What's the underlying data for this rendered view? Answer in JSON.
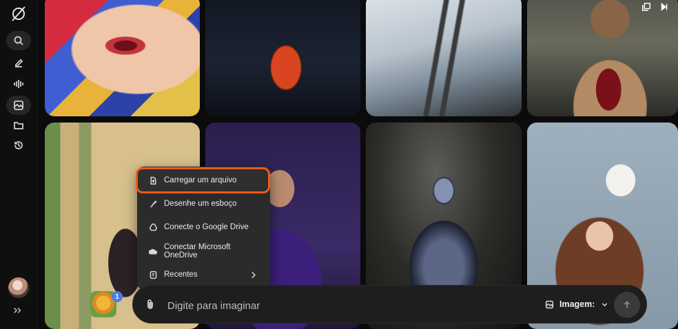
{
  "menu": {
    "items": [
      {
        "label": "Carregar um arquivo",
        "icon": "upload-file-icon",
        "highlighted": true
      },
      {
        "label": "Desenhe um esboço",
        "icon": "brush-icon"
      },
      {
        "label": "Conecte o Google Drive",
        "icon": "google-drive-icon"
      },
      {
        "label": "Conectar Microsoft OneDrive",
        "icon": "onedrive-icon"
      },
      {
        "label": "Recentes",
        "icon": "recent-files-icon",
        "has_submenu": true
      }
    ]
  },
  "prompt": {
    "placeholder": "Digite para imaginar",
    "mode_label": "Imagem:"
  },
  "extension": {
    "badge_count": "1"
  },
  "colors": {
    "highlight_outline": "#f15a1a",
    "badge": "#4a7de6"
  }
}
